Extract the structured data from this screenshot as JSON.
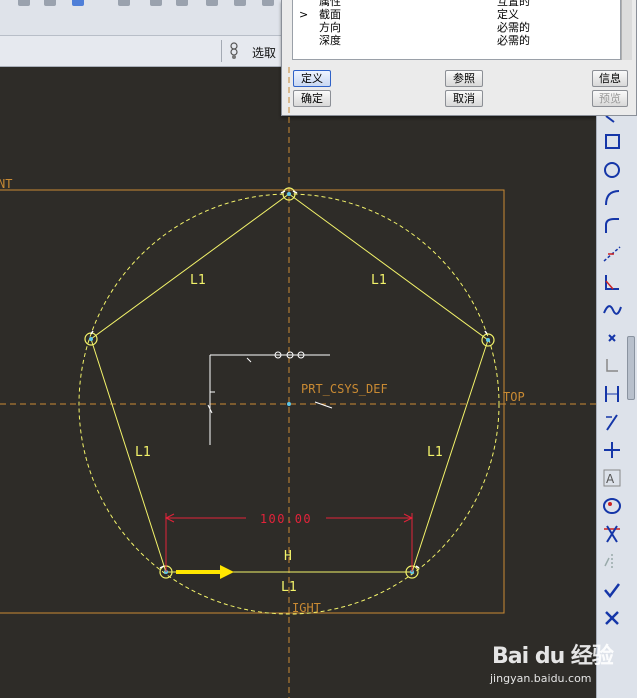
{
  "select_bar": {
    "label": "选取"
  },
  "dialog": {
    "rows": [
      {
        "arrow": "",
        "name": "属性",
        "status": "互置的"
      },
      {
        "arrow": ">",
        "name": "截面",
        "status": "定义"
      },
      {
        "arrow": "",
        "name": "方向",
        "status": "必需的"
      },
      {
        "arrow": "",
        "name": "深度",
        "status": "必需的"
      }
    ],
    "buttons": {
      "define": "定义",
      "ok": "确定",
      "refs": "参照",
      "cancel": "取消",
      "info": "信息",
      "preview": "预览"
    }
  },
  "sketch": {
    "dimension": "100.00",
    "coord_sys": "PRT_CSYS_DEF",
    "plane_top": "TOP",
    "plane_front": "NT",
    "plane_right": "IGHT",
    "constraint_equal": "L1",
    "constraint_horizontal": "H"
  },
  "colors": {
    "background": "#2e2c28",
    "sketch": "#f3f36a",
    "datum": "#c98a33",
    "dimension": "#e2233a",
    "toolbar_icon": "#1536a8"
  },
  "watermark": {
    "brand": "Bai du 经验",
    "url": "jingyan.baidu.com"
  }
}
